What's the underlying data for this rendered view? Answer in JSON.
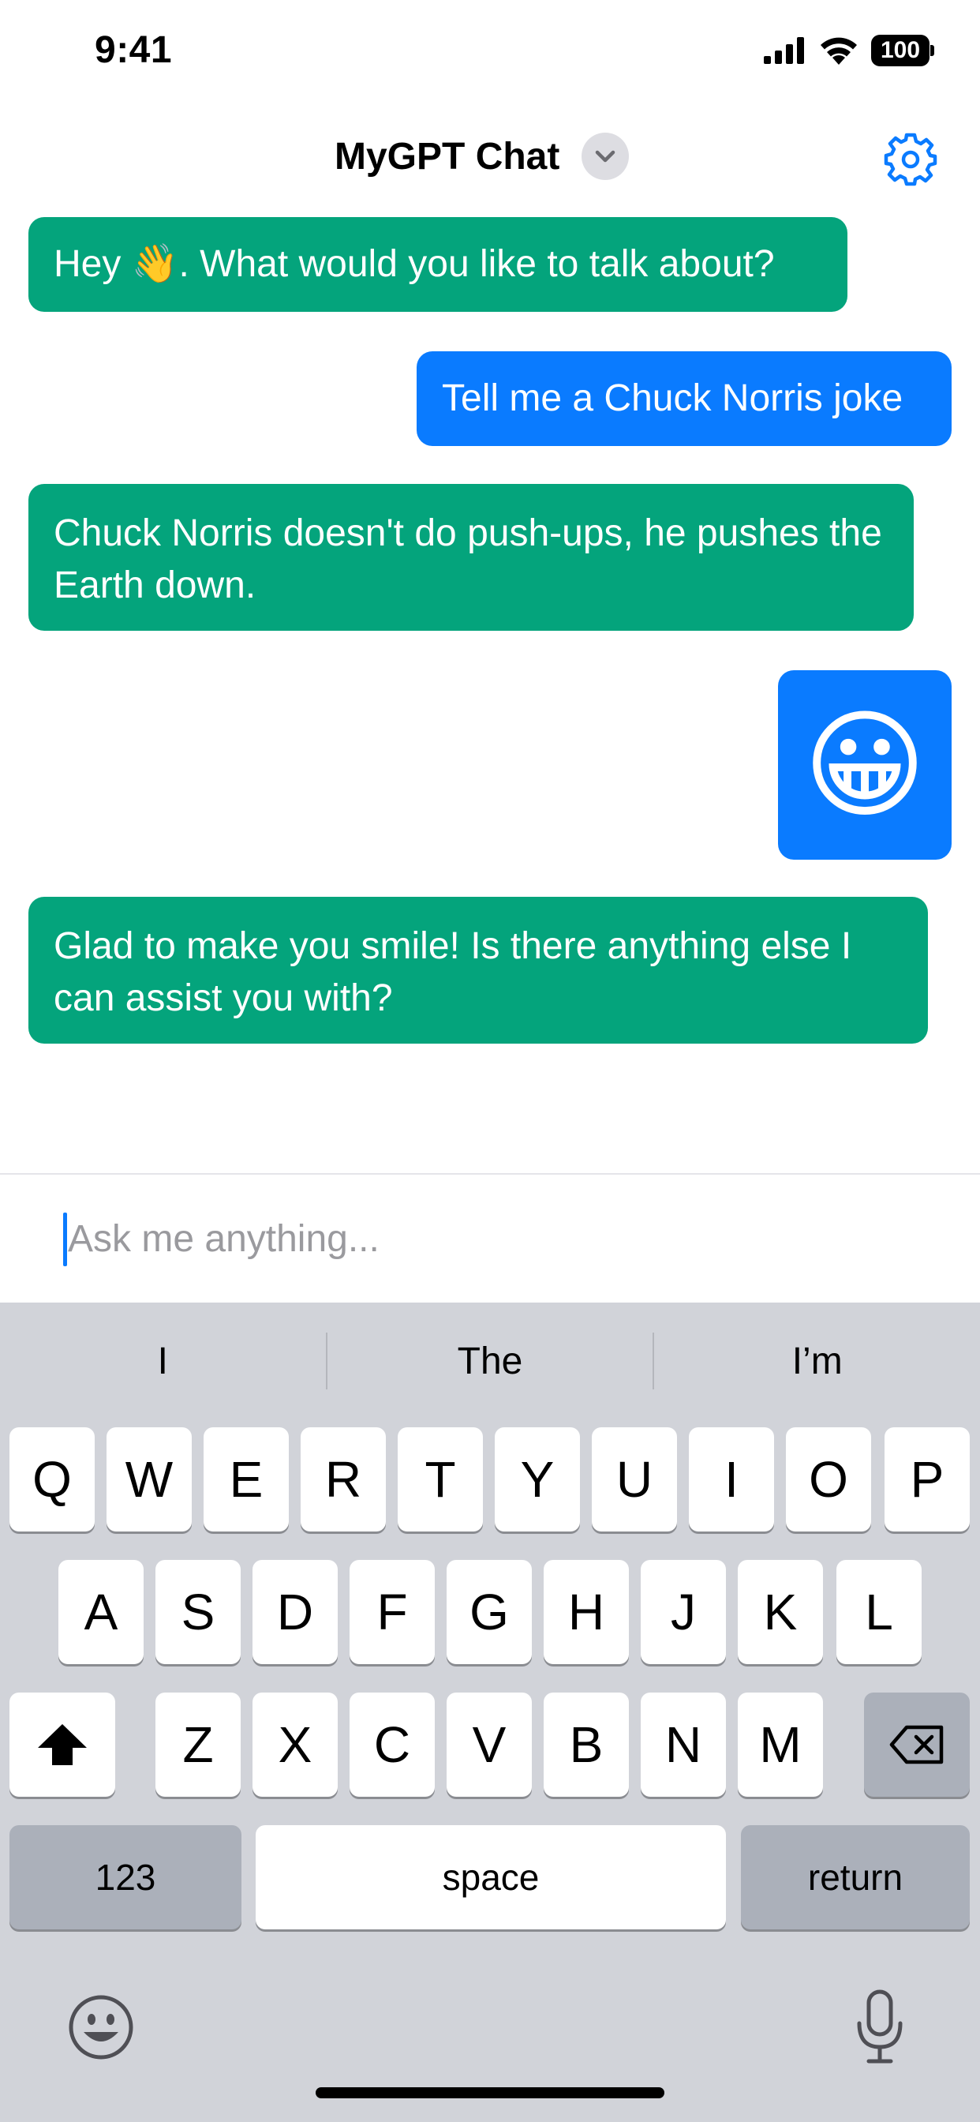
{
  "status_bar": {
    "time": "9:41",
    "battery": "100"
  },
  "header": {
    "title": "MyGPT Chat"
  },
  "messages": [
    {
      "role": "bot",
      "text": "Hey 👋. What would you like to talk about?"
    },
    {
      "role": "user",
      "text": "Tell me a Chuck Norris joke"
    },
    {
      "role": "bot",
      "text": "Chuck Norris doesn't do push-ups, he pushes the Earth down."
    },
    {
      "role": "user",
      "text": "😀"
    },
    {
      "role": "bot",
      "text": "Glad to make you smile! Is there anything else I can assist you with?"
    }
  ],
  "input": {
    "placeholder": "Ask me anything...",
    "value": ""
  },
  "keyboard": {
    "suggestions": [
      "I",
      "The",
      "I’m"
    ],
    "row1": [
      "Q",
      "W",
      "E",
      "R",
      "T",
      "Y",
      "U",
      "I",
      "O",
      "P"
    ],
    "row2": [
      "A",
      "S",
      "D",
      "F",
      "G",
      "H",
      "J",
      "K",
      "L"
    ],
    "row3": [
      "Z",
      "X",
      "C",
      "V",
      "B",
      "N",
      "M"
    ],
    "numbers_label": "123",
    "space_label": "space",
    "return_label": "return"
  },
  "colors": {
    "bot_bubble": "#04a47c",
    "user_bubble": "#0a7bff",
    "accent": "#0a7bff",
    "keyboard_bg": "#d1d3d9"
  },
  "icons": [
    "signal-icon",
    "wifi-icon",
    "battery-icon",
    "chevron-down-icon",
    "gear-icon",
    "shift-icon",
    "backspace-icon",
    "emoji-icon",
    "microphone-icon"
  ]
}
